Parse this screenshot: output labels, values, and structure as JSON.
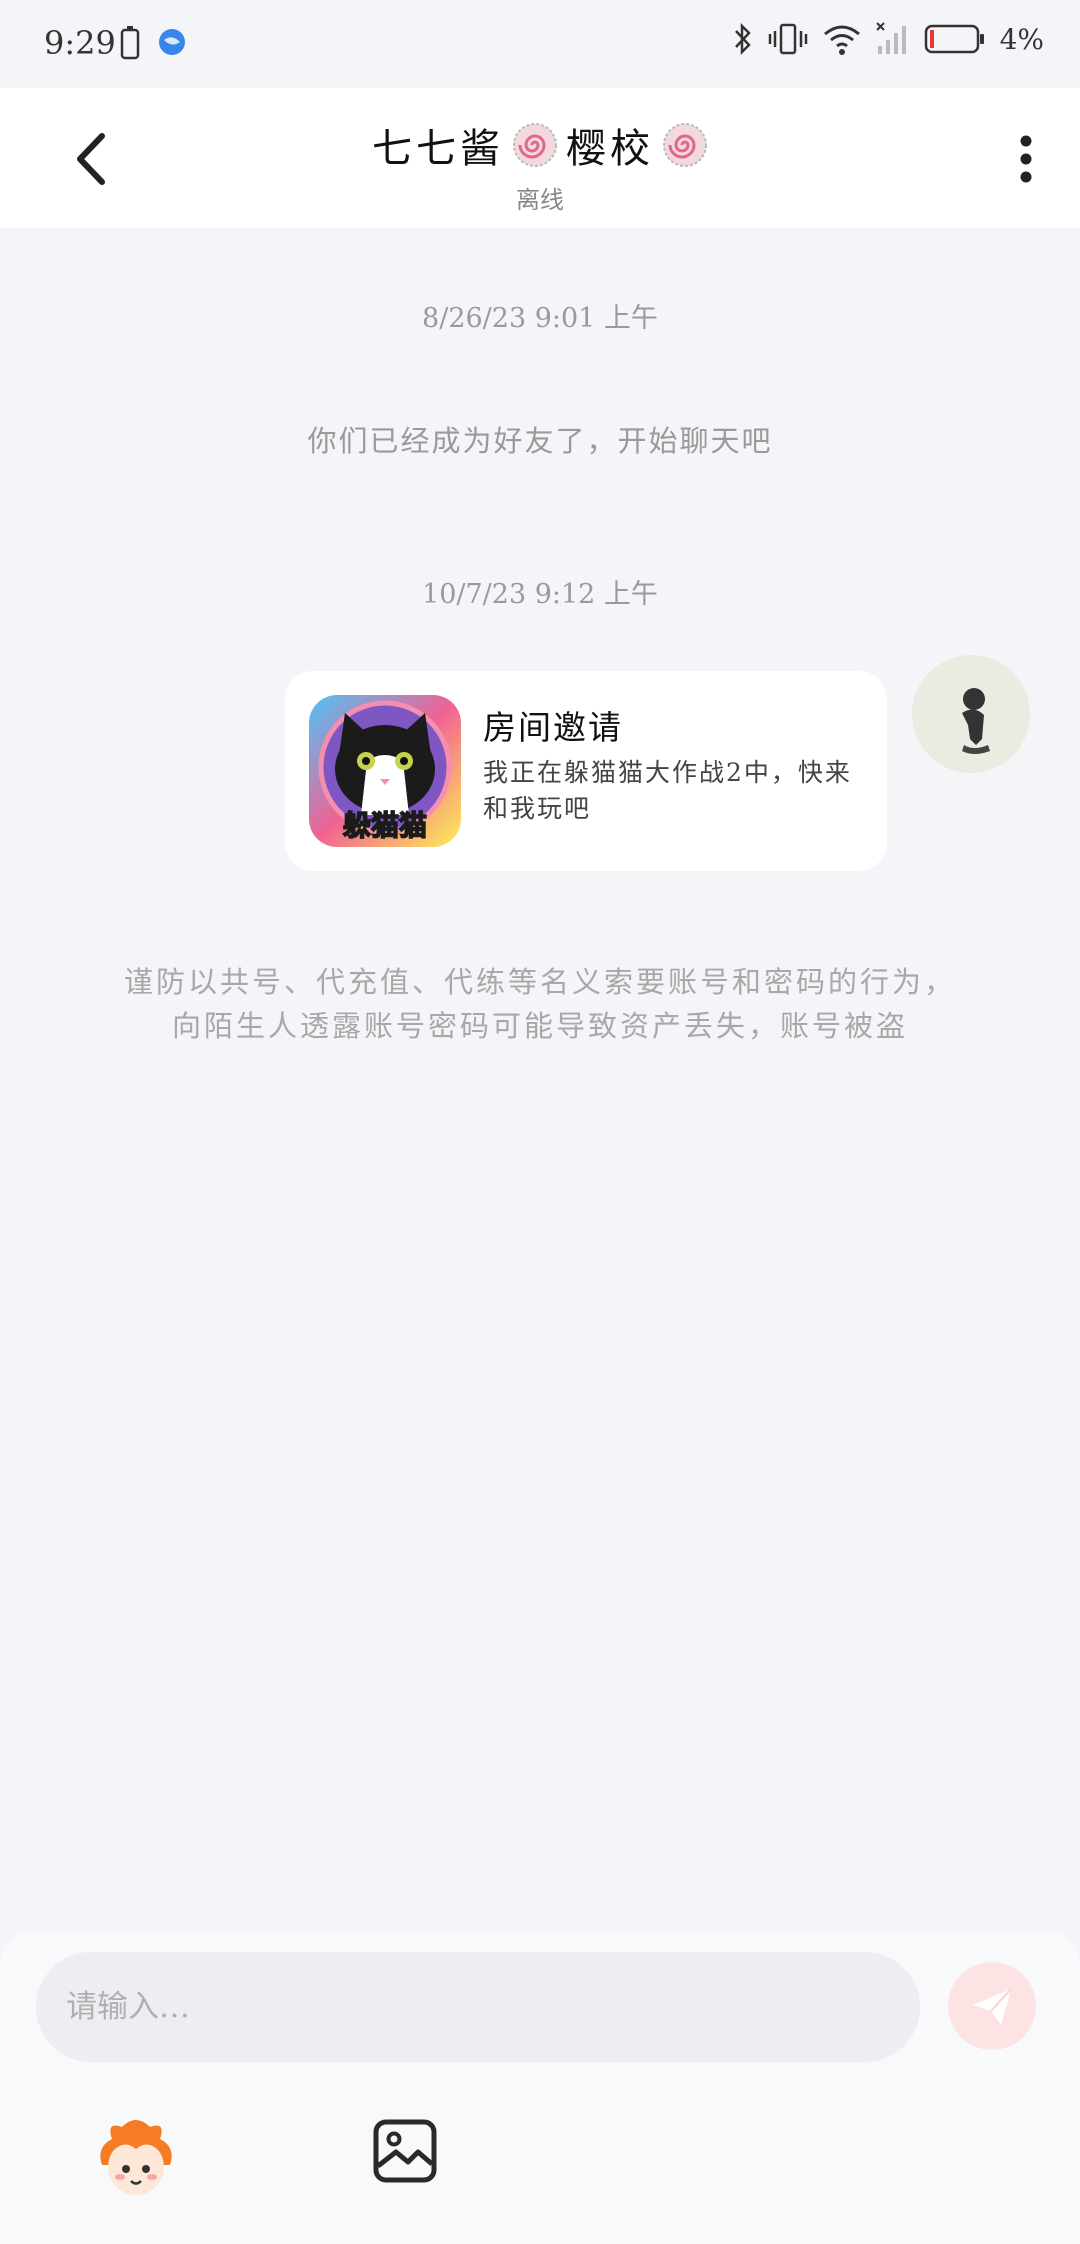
{
  "status_bar": {
    "time": "9:29",
    "battery_percent": "4%"
  },
  "header": {
    "title_left": "七七酱",
    "title_mid": "樱校",
    "status": "离线"
  },
  "messages": {
    "timestamp_1": "8/26/23 9:01 上午",
    "system_friend": "你们已经成为好友了，开始聊天吧",
    "timestamp_2": "10/7/23 9:12 上午",
    "invite": {
      "title": "房间邀请",
      "description": "我正在躲猫猫大作战2中，快来和我玩吧",
      "game_icon_text": "躲猫猫"
    }
  },
  "warning": {
    "line1": "谨防以共号、代充值、代练等名义索要账号和密码的行为，",
    "line2": "向陌生人透露账号密码可能导致资产丢失，账号被盗"
  },
  "composer": {
    "placeholder": "请输入…"
  },
  "colors": {
    "background": "#f3f5f8",
    "send_button": "#fde3e3"
  }
}
